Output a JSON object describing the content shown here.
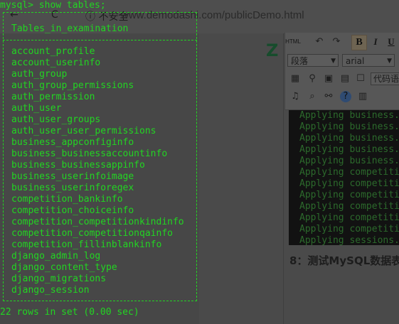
{
  "browser": {
    "url": "www.demodashi.com/publicDemo.html",
    "security_label": "不安全"
  },
  "editor": {
    "html_label": "HTML",
    "bold": "B",
    "italic": "I",
    "underline": "U",
    "paragraph_select": "段落",
    "font_select": "arial",
    "code_select": "代码语"
  },
  "code_output": {
    "lines": [
      "Applying business.",
      "Applying business.",
      "Applying business.",
      "Applying business.",
      "Applying business.",
      "Applying competiti",
      "Applying competiti",
      "Applying competiti",
      "Applying competiti",
      "Applying competiti",
      "Applying competiti",
      "Applying sessions."
    ]
  },
  "article": {
    "section_heading": "8：测试MySQL数据表"
  },
  "terminal": {
    "command": "mysql> show tables;",
    "top_border": "+---------------------------------+",
    "column_header": "| Tables_in_examination           |",
    "tables": [
      "account_profile",
      "account_userinfo",
      "auth_group",
      "auth_group_permissions",
      "auth_permission",
      "auth_user",
      "auth_user_groups",
      "auth_user_user_permissions",
      "business_appconfiginfo",
      "business_businessaccountinfo",
      "business_businessappinfo",
      "business_userinfoimage",
      "business_userinforegex",
      "competition_bankinfo",
      "competition_choiceinfo",
      "competition_competitionkindinfo",
      "competition_competitionqainfo",
      "competition_fillinblankinfo",
      "django_admin_log",
      "django_content_type",
      "django_migrations",
      "django_session"
    ],
    "footer": "22 rows in set (0.00 sec)"
  }
}
